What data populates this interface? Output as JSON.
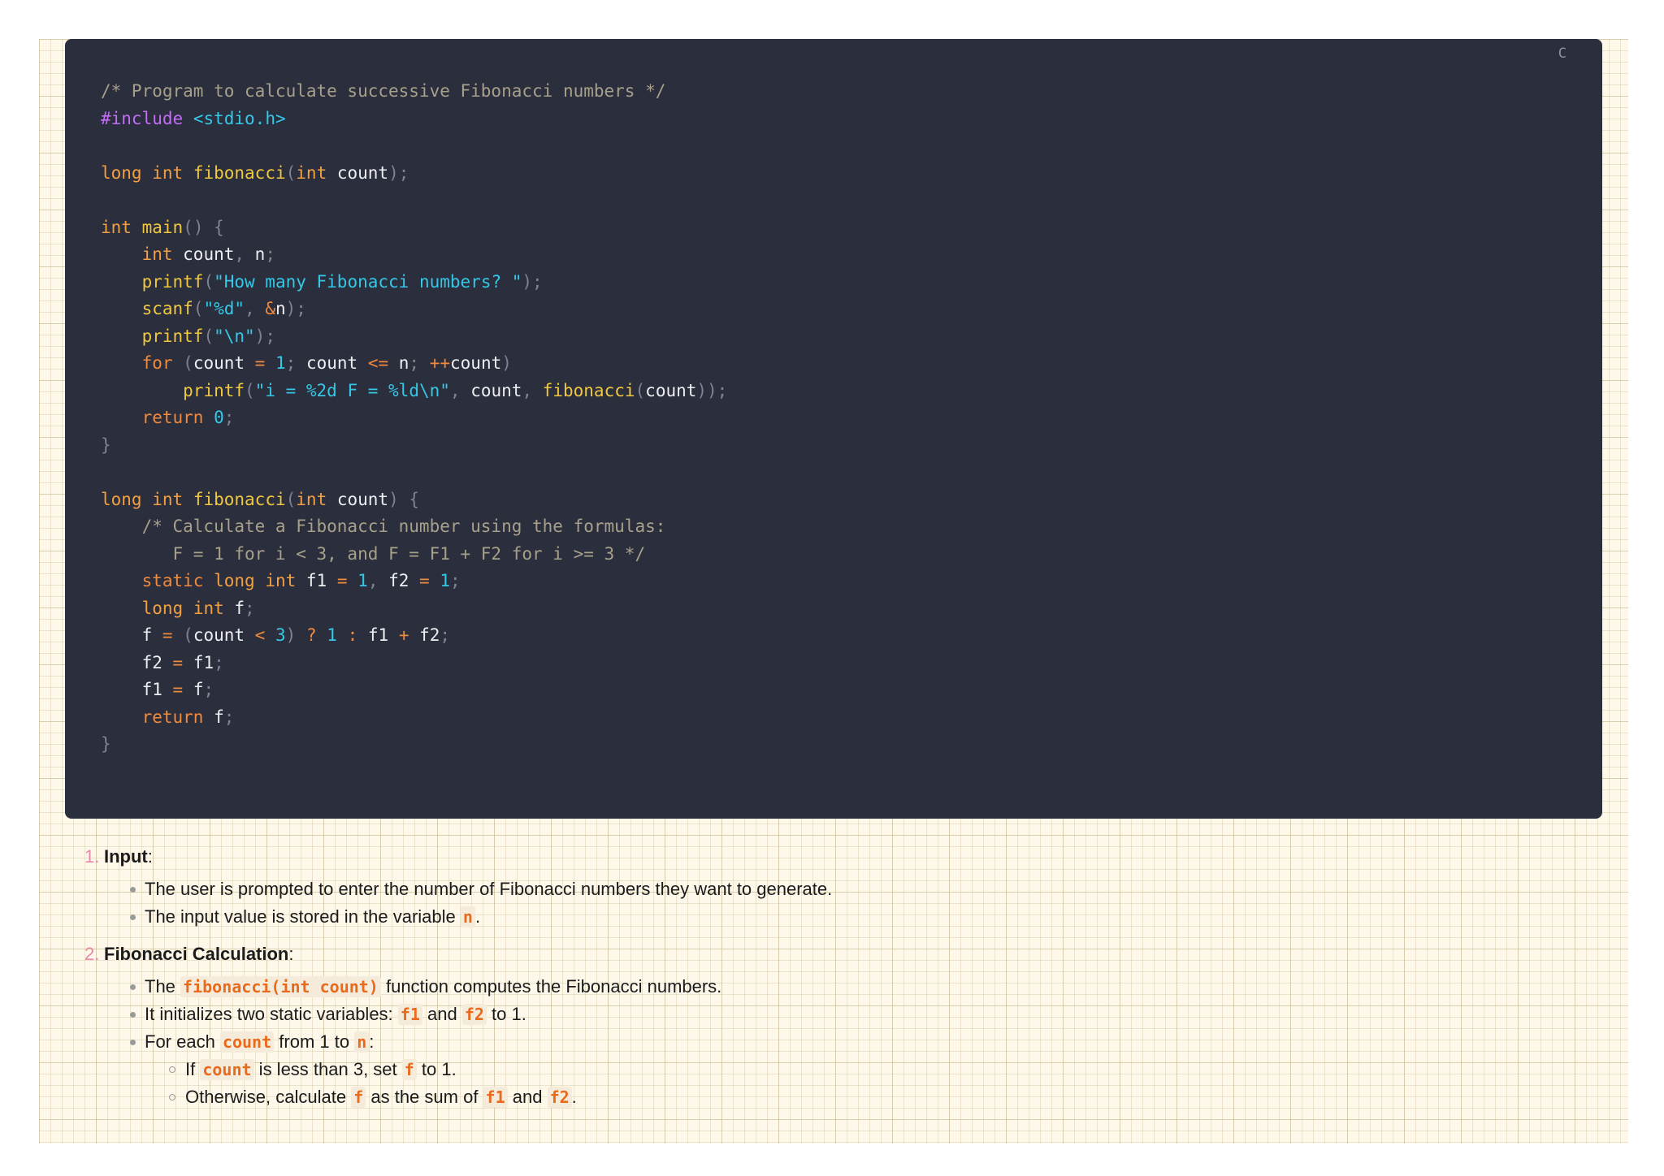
{
  "code_block": {
    "language": "C",
    "lines": [
      [
        {
          "t": "/* Program to calculate successive Fibonacci numbers */",
          "c": "comment"
        }
      ],
      [
        {
          "t": "#include",
          "c": "macro"
        },
        {
          "t": " ",
          "c": "plain"
        },
        {
          "t": "<stdio.h>",
          "c": "header"
        }
      ],
      [],
      [
        {
          "t": "long",
          "c": "type"
        },
        {
          "t": " ",
          "c": "plain"
        },
        {
          "t": "int",
          "c": "type"
        },
        {
          "t": " ",
          "c": "plain"
        },
        {
          "t": "fibonacci",
          "c": "fn"
        },
        {
          "t": "(",
          "c": "punct"
        },
        {
          "t": "int",
          "c": "type"
        },
        {
          "t": " count",
          "c": "plain"
        },
        {
          "t": ");",
          "c": "punct"
        }
      ],
      [],
      [
        {
          "t": "int",
          "c": "type"
        },
        {
          "t": " ",
          "c": "plain"
        },
        {
          "t": "main",
          "c": "fn"
        },
        {
          "t": "() {",
          "c": "punct"
        }
      ],
      [
        {
          "t": "    ",
          "c": "plain"
        },
        {
          "t": "int",
          "c": "type"
        },
        {
          "t": " count",
          "c": "plain"
        },
        {
          "t": ",",
          "c": "punct"
        },
        {
          "t": " n",
          "c": "plain"
        },
        {
          "t": ";",
          "c": "punct"
        }
      ],
      [
        {
          "t": "    ",
          "c": "plain"
        },
        {
          "t": "printf",
          "c": "fn"
        },
        {
          "t": "(",
          "c": "punct"
        },
        {
          "t": "\"How many Fibonacci numbers? \"",
          "c": "str"
        },
        {
          "t": ");",
          "c": "punct"
        }
      ],
      [
        {
          "t": "    ",
          "c": "plain"
        },
        {
          "t": "scanf",
          "c": "fn"
        },
        {
          "t": "(",
          "c": "punct"
        },
        {
          "t": "\"%d\"",
          "c": "str"
        },
        {
          "t": ", ",
          "c": "punct"
        },
        {
          "t": "&",
          "c": "op"
        },
        {
          "t": "n",
          "c": "plain"
        },
        {
          "t": ");",
          "c": "punct"
        }
      ],
      [
        {
          "t": "    ",
          "c": "plain"
        },
        {
          "t": "printf",
          "c": "fn"
        },
        {
          "t": "(",
          "c": "punct"
        },
        {
          "t": "\"\\n\"",
          "c": "str"
        },
        {
          "t": ");",
          "c": "punct"
        }
      ],
      [
        {
          "t": "    ",
          "c": "plain"
        },
        {
          "t": "for",
          "c": "kw"
        },
        {
          "t": " (",
          "c": "punct"
        },
        {
          "t": "count ",
          "c": "plain"
        },
        {
          "t": "=",
          "c": "op"
        },
        {
          "t": " ",
          "c": "plain"
        },
        {
          "t": "1",
          "c": "num"
        },
        {
          "t": ";",
          "c": "punct"
        },
        {
          "t": " count ",
          "c": "plain"
        },
        {
          "t": "<=",
          "c": "op"
        },
        {
          "t": " n",
          "c": "plain"
        },
        {
          "t": ";",
          "c": "punct"
        },
        {
          "t": " ",
          "c": "plain"
        },
        {
          "t": "++",
          "c": "op"
        },
        {
          "t": "count",
          "c": "plain"
        },
        {
          "t": ")",
          "c": "punct"
        }
      ],
      [
        {
          "t": "        ",
          "c": "plain"
        },
        {
          "t": "printf",
          "c": "fn"
        },
        {
          "t": "(",
          "c": "punct"
        },
        {
          "t": "\"i = %2d F = %ld\\n\"",
          "c": "str"
        },
        {
          "t": ",",
          "c": "punct"
        },
        {
          "t": " count",
          "c": "plain"
        },
        {
          "t": ",",
          "c": "punct"
        },
        {
          "t": " ",
          "c": "plain"
        },
        {
          "t": "fibonacci",
          "c": "fn"
        },
        {
          "t": "(",
          "c": "punct"
        },
        {
          "t": "count",
          "c": "plain"
        },
        {
          "t": "));",
          "c": "punct"
        }
      ],
      [
        {
          "t": "    ",
          "c": "plain"
        },
        {
          "t": "return",
          "c": "kw"
        },
        {
          "t": " ",
          "c": "plain"
        },
        {
          "t": "0",
          "c": "num"
        },
        {
          "t": ";",
          "c": "punct"
        }
      ],
      [
        {
          "t": "}",
          "c": "punct"
        }
      ],
      [],
      [
        {
          "t": "long",
          "c": "type"
        },
        {
          "t": " ",
          "c": "plain"
        },
        {
          "t": "int",
          "c": "type"
        },
        {
          "t": " ",
          "c": "plain"
        },
        {
          "t": "fibonacci",
          "c": "fn"
        },
        {
          "t": "(",
          "c": "punct"
        },
        {
          "t": "int",
          "c": "type"
        },
        {
          "t": " count",
          "c": "plain"
        },
        {
          "t": ") {",
          "c": "punct"
        }
      ],
      [
        {
          "t": "    /* Calculate a Fibonacci number using the formulas:",
          "c": "comment"
        }
      ],
      [
        {
          "t": "       F = 1 for i < 3, and F = F1 + F2 for i >= 3 */",
          "c": "comment"
        }
      ],
      [
        {
          "t": "    ",
          "c": "plain"
        },
        {
          "t": "static",
          "c": "kw"
        },
        {
          "t": " ",
          "c": "plain"
        },
        {
          "t": "long",
          "c": "type"
        },
        {
          "t": " ",
          "c": "plain"
        },
        {
          "t": "int",
          "c": "type"
        },
        {
          "t": " f1 ",
          "c": "plain"
        },
        {
          "t": "=",
          "c": "op"
        },
        {
          "t": " ",
          "c": "plain"
        },
        {
          "t": "1",
          "c": "num"
        },
        {
          "t": ",",
          "c": "punct"
        },
        {
          "t": " f2 ",
          "c": "plain"
        },
        {
          "t": "=",
          "c": "op"
        },
        {
          "t": " ",
          "c": "plain"
        },
        {
          "t": "1",
          "c": "num"
        },
        {
          "t": ";",
          "c": "punct"
        }
      ],
      [
        {
          "t": "    ",
          "c": "plain"
        },
        {
          "t": "long",
          "c": "type"
        },
        {
          "t": " ",
          "c": "plain"
        },
        {
          "t": "int",
          "c": "type"
        },
        {
          "t": " f",
          "c": "plain"
        },
        {
          "t": ";",
          "c": "punct"
        }
      ],
      [
        {
          "t": "    f ",
          "c": "plain"
        },
        {
          "t": "=",
          "c": "op"
        },
        {
          "t": " (",
          "c": "punct"
        },
        {
          "t": "count ",
          "c": "plain"
        },
        {
          "t": "<",
          "c": "op"
        },
        {
          "t": " ",
          "c": "plain"
        },
        {
          "t": "3",
          "c": "num"
        },
        {
          "t": ")",
          "c": "punct"
        },
        {
          "t": " ",
          "c": "plain"
        },
        {
          "t": "?",
          "c": "op"
        },
        {
          "t": " ",
          "c": "plain"
        },
        {
          "t": "1",
          "c": "num"
        },
        {
          "t": " ",
          "c": "plain"
        },
        {
          "t": ":",
          "c": "op"
        },
        {
          "t": " f1 ",
          "c": "plain"
        },
        {
          "t": "+",
          "c": "op"
        },
        {
          "t": " f2",
          "c": "plain"
        },
        {
          "t": ";",
          "c": "punct"
        }
      ],
      [
        {
          "t": "    f2 ",
          "c": "plain"
        },
        {
          "t": "=",
          "c": "op"
        },
        {
          "t": " f1",
          "c": "plain"
        },
        {
          "t": ";",
          "c": "punct"
        }
      ],
      [
        {
          "t": "    f1 ",
          "c": "plain"
        },
        {
          "t": "=",
          "c": "op"
        },
        {
          "t": " f",
          "c": "plain"
        },
        {
          "t": ";",
          "c": "punct"
        }
      ],
      [
        {
          "t": "    ",
          "c": "plain"
        },
        {
          "t": "return",
          "c": "kw"
        },
        {
          "t": " f",
          "c": "plain"
        },
        {
          "t": ";",
          "c": "punct"
        }
      ],
      [
        {
          "t": "}",
          "c": "punct"
        }
      ]
    ]
  },
  "explanation": {
    "sections": [
      {
        "number": "1.",
        "title": "Input",
        "suffix": ":",
        "bullets": [
          {
            "parts": [
              {
                "t": "The user is prompted to enter the number of Fibonacci numbers they want to generate."
              }
            ]
          },
          {
            "parts": [
              {
                "t": "The input value is stored in the variable "
              },
              {
                "code": "n"
              },
              {
                "t": "."
              }
            ]
          }
        ]
      },
      {
        "number": "2.",
        "title": "Fibonacci Calculation",
        "suffix": ":",
        "bullets": [
          {
            "parts": [
              {
                "t": "The "
              },
              {
                "code": "fibonacci(int count)"
              },
              {
                "t": " function computes the Fibonacci numbers."
              }
            ]
          },
          {
            "parts": [
              {
                "t": "It initializes two static variables: "
              },
              {
                "code": "f1"
              },
              {
                "t": " and "
              },
              {
                "code": "f2"
              },
              {
                "t": " to 1."
              }
            ]
          },
          {
            "parts": [
              {
                "t": "For each "
              },
              {
                "code": "count"
              },
              {
                "t": " from 1 to "
              },
              {
                "code": "n"
              },
              {
                "t": ":"
              }
            ],
            "sub": [
              {
                "parts": [
                  {
                    "t": "If "
                  },
                  {
                    "code": "count"
                  },
                  {
                    "t": " is less than 3, set "
                  },
                  {
                    "code": "f"
                  },
                  {
                    "t": " to 1."
                  }
                ]
              },
              {
                "parts": [
                  {
                    "t": "Otherwise, calculate "
                  },
                  {
                    "code": "f"
                  },
                  {
                    "t": " as the sum of "
                  },
                  {
                    "code": "f1"
                  },
                  {
                    "t": " and "
                  },
                  {
                    "code": "f2"
                  },
                  {
                    "t": "."
                  }
                ]
              }
            ]
          }
        ]
      }
    ]
  }
}
